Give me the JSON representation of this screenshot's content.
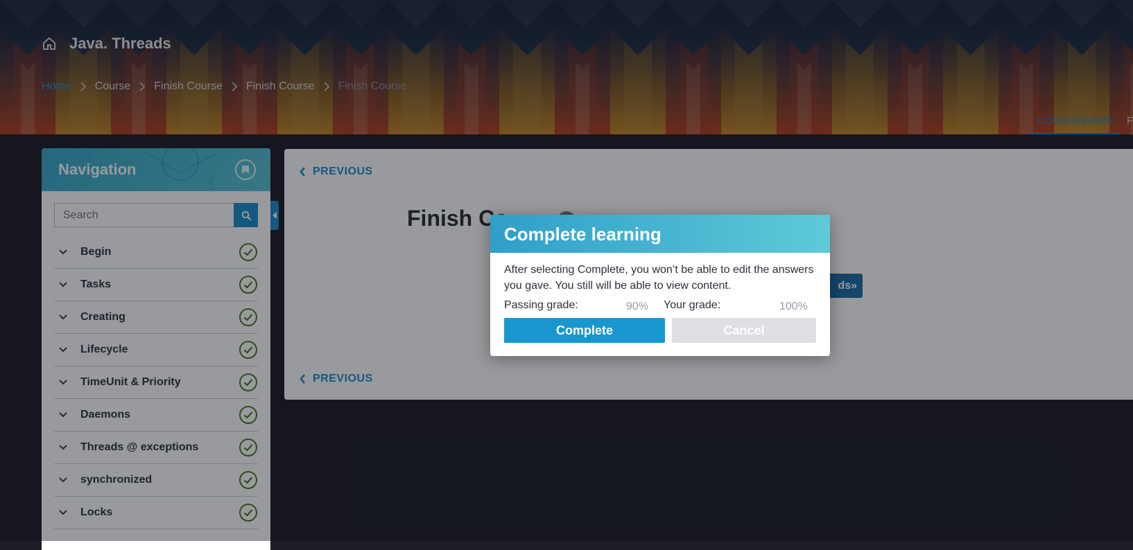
{
  "header": {
    "course_title": "Java. Threads",
    "breadcrumb": [
      {
        "label": "Home"
      },
      {
        "label": "Course"
      },
      {
        "label": "Finish Course"
      },
      {
        "label": "Finish Course"
      },
      {
        "label": "Finish Course"
      }
    ],
    "tabs": {
      "courseware": "COURSEWARE",
      "next": "F"
    }
  },
  "sidebar": {
    "title": "Navigation",
    "search_placeholder": "Search",
    "items": [
      {
        "label": "Begin"
      },
      {
        "label": "Tasks"
      },
      {
        "label": "Creating"
      },
      {
        "label": "Lifecycle"
      },
      {
        "label": "TimeUnit & Priority"
      },
      {
        "label": "Daemons"
      },
      {
        "label": "Threads @ exceptions"
      },
      {
        "label": "synchronized"
      },
      {
        "label": "Locks"
      }
    ]
  },
  "content": {
    "previous_top": "PREVIOUS",
    "previous_bottom": "PREVIOUS",
    "heading": "Finish Co",
    "primary_link": "ds»"
  },
  "modal": {
    "title": "Complete learning",
    "message": "After selecting Complete, you won’t be able to edit the answers you gave. You still will be able to view content.",
    "passing_label": "Passing grade:",
    "passing_value": "90%",
    "your_label": "Your grade:",
    "your_value": "100%",
    "complete_label": "Complete",
    "cancel_label": "Cancel"
  },
  "colors": {
    "accent": "#1a8ecc",
    "check": "#4a7a1e",
    "modal_header": "#3aaed0"
  },
  "icons": [
    "home-icon",
    "chevron-right-icon",
    "bookmark-icon",
    "search-icon",
    "chevron-down-icon",
    "check-circle-icon",
    "chevron-left-icon",
    "caret-left-icon"
  ]
}
